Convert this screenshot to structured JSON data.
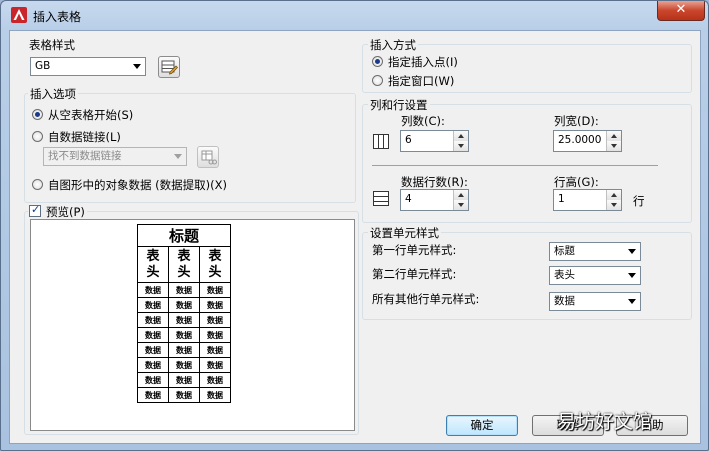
{
  "window": {
    "title": "插入表格",
    "close_label": "✕"
  },
  "table_style": {
    "group_label": "表格样式",
    "selected": "GB"
  },
  "insert_options": {
    "group_label": "插入选项",
    "opt_empty": "从空表格开始(S)",
    "opt_datalink": "自数据链接(L)",
    "datalink_placeholder": "找不到数据链接",
    "opt_extract": "自图形中的对象数据 (数据提取)(X)",
    "selected": "opt_empty"
  },
  "preview": {
    "label": "预览(P)",
    "checked": true,
    "title": "标题",
    "header_cells": [
      "表\n头",
      "表\n头",
      "表\n头"
    ],
    "data_cell": "数据",
    "data_rows": 8
  },
  "insert_method": {
    "group_label": "插入方式",
    "opt_point": "指定插入点(I)",
    "opt_window": "指定窗口(W)",
    "selected": "opt_point"
  },
  "col_row": {
    "group_label": "列和行设置",
    "columns_label": "列数(C):",
    "columns_value": "6",
    "col_width_label": "列宽(D):",
    "col_width_value": "25.0000",
    "data_rows_label": "数据行数(R):",
    "data_rows_value": "4",
    "row_height_label": "行高(G):",
    "row_height_value": "1",
    "row_unit": "行"
  },
  "cell_styles": {
    "group_label": "设置单元样式",
    "first_row_label": "第一行单元样式:",
    "first_row_value": "标题",
    "second_row_label": "第二行单元样式:",
    "second_row_value": "表头",
    "other_rows_label": "所有其他行单元样式:",
    "other_rows_value": "数据"
  },
  "buttons": {
    "ok": "确定",
    "cancel": "取消",
    "help": "帮助"
  },
  "watermark": "易坊好文馆",
  "colors": {
    "accent": "#1a3b8c",
    "title_bar": "#b9cfe8",
    "close": "#c9462c"
  }
}
